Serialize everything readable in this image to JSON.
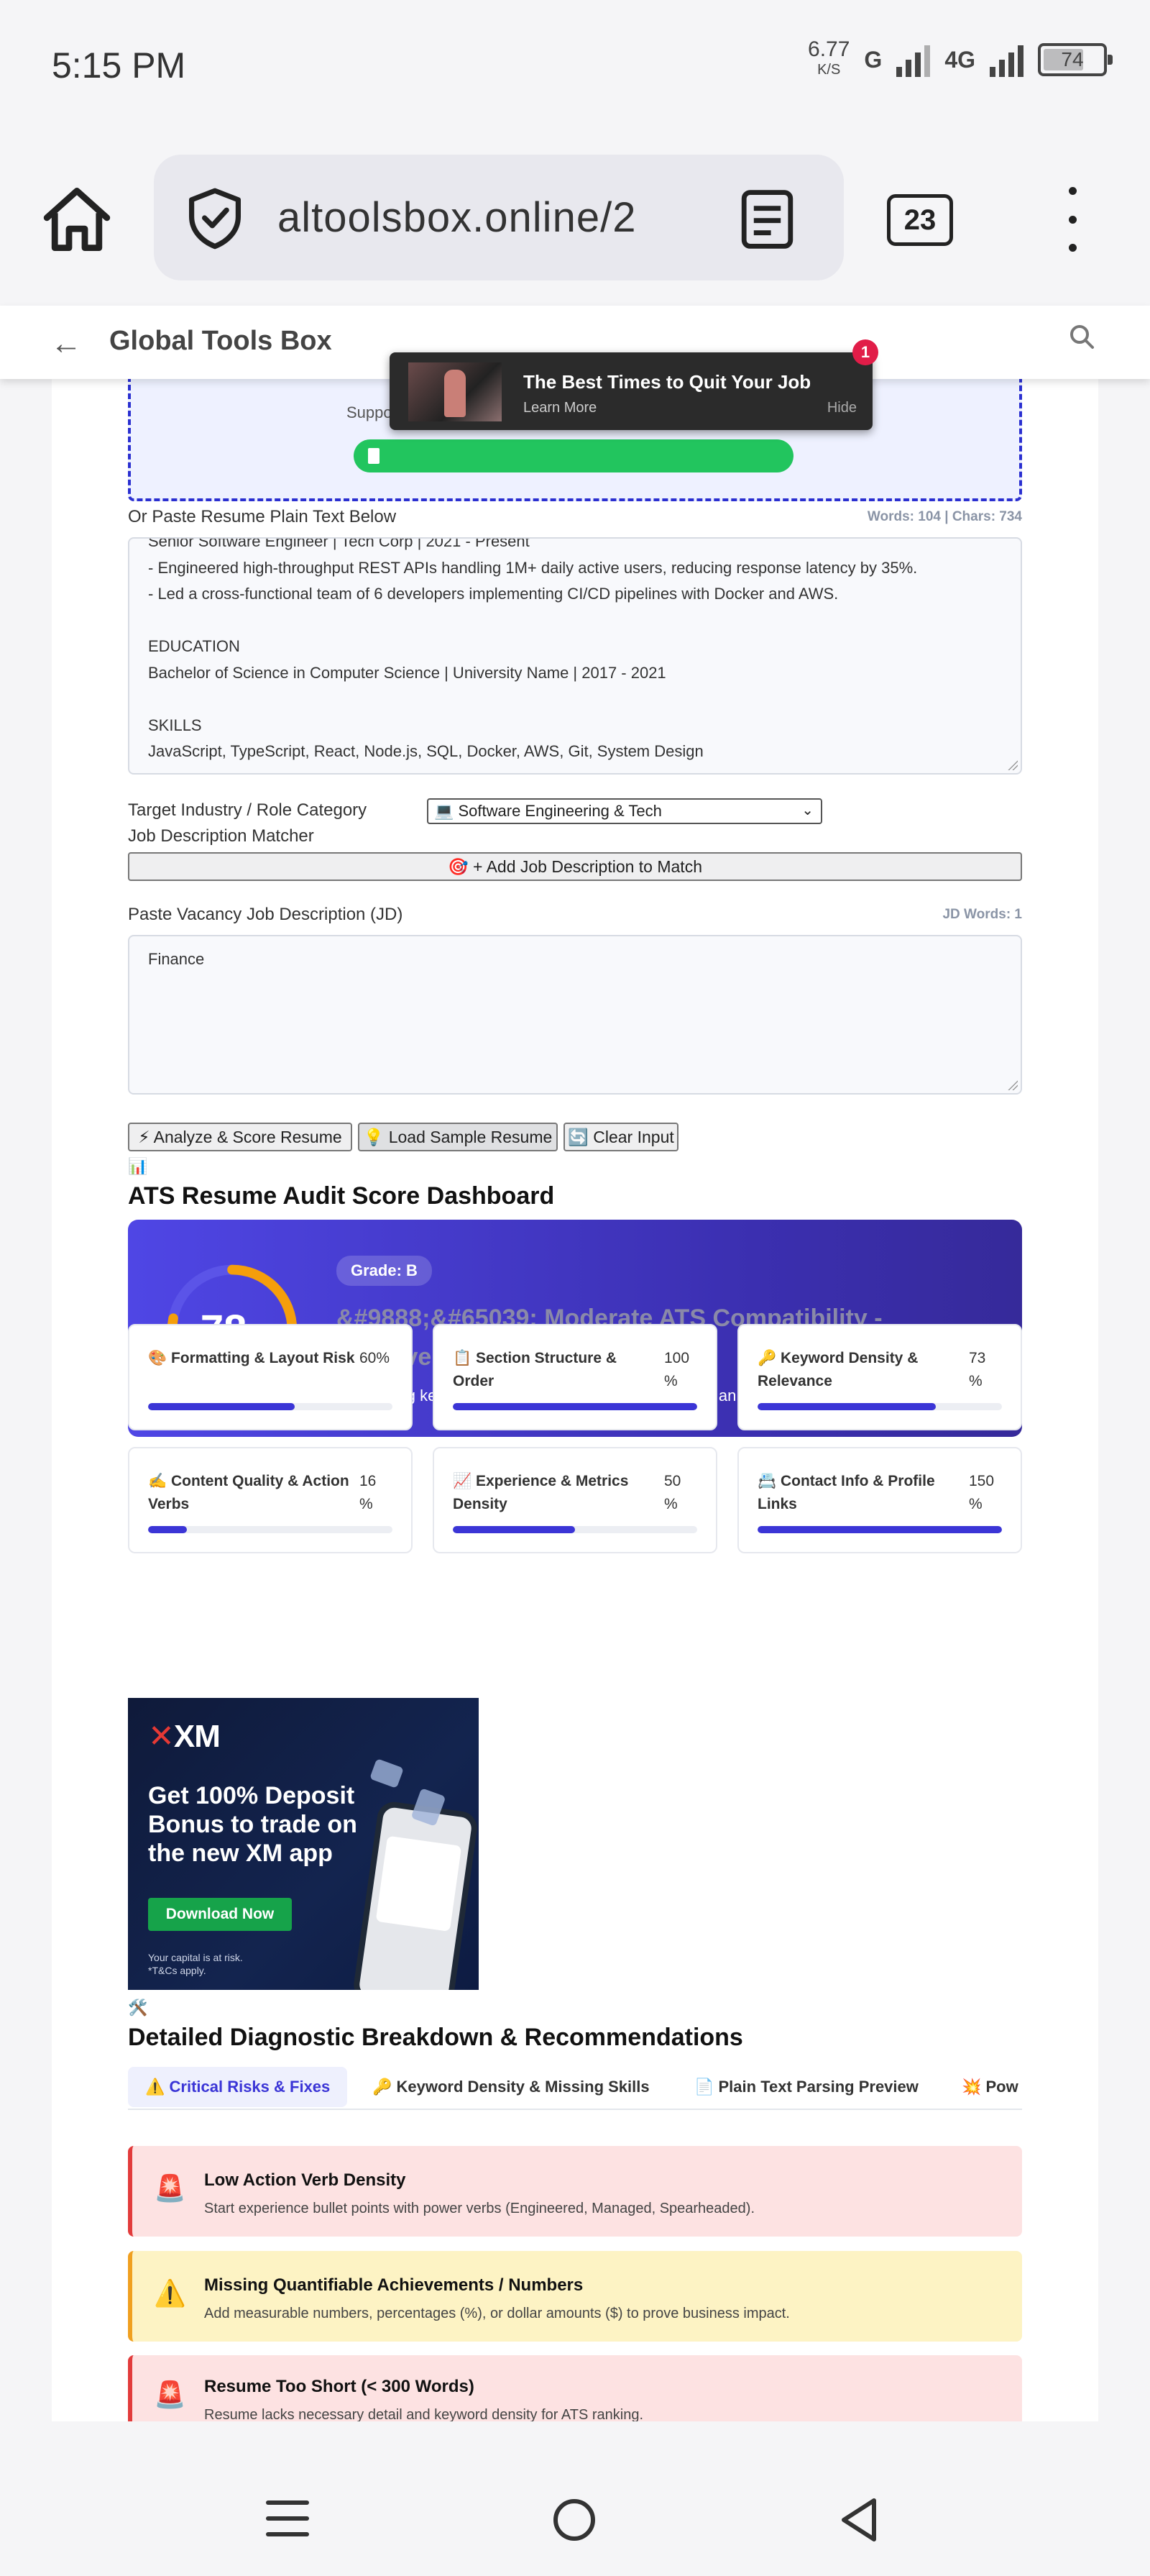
{
  "status": {
    "time": "5:15 PM",
    "net_speed": "6.77",
    "net_unit": "K/S",
    "sig1": "G",
    "sig2": "4G",
    "battery": "74"
  },
  "browser": {
    "url": "altoolsbox.online/2",
    "tab_count": "23"
  },
  "site": {
    "title": "Global Tools Box"
  },
  "toast": {
    "title": "The Best Times to Quit Your Job",
    "sub": "Learn More",
    "hide": "Hide",
    "badge": "1"
  },
  "upload": {
    "support_text": "Suppo"
  },
  "resume": {
    "label": "Or Paste Resume Plain Text Below",
    "counts": "Words: 104 | Chars: 734",
    "lines": [
      "Senior Software Engineer | Tech Corp | 2021 - Present",
      "- Engineered high-throughput REST APIs handling 1M+ daily active users, reducing response latency by 35%.",
      "- Led a cross-functional team of 6 developers implementing CI/CD pipelines with Docker and AWS.",
      "",
      "EDUCATION",
      "Bachelor of Science in Computer Science | University Name | 2017 - 2021",
      "",
      "SKILLS",
      "JavaScript, TypeScript, React, Node.js, SQL, Docker, AWS, Git, System Design"
    ]
  },
  "industry": {
    "label": "Target Industry / Role Category",
    "selected": "💻 Software Engineering & Tech"
  },
  "jd": {
    "matcher_label": "Job Description Matcher",
    "add_button": "🎯 + Add Job Description to Match",
    "label": "Paste Vacancy Job Description (JD)",
    "count": "JD Words: 1",
    "value": "Finance"
  },
  "actions": {
    "analyze": "⚡ Analyze & Score Resume",
    "sample": "💡 Load Sample Resume",
    "clear": "🔄 Clear Input"
  },
  "dashboard": {
    "icon": "📊",
    "title": "ATS Resume Audit Score Dashboard",
    "score": "78",
    "score_unit": "%",
    "score_value": 78,
    "grade": "Grade: B",
    "verdict": "&#9888;&#65039; Moderate ATS Compatibility - Improvements Recommended",
    "verdict_sub": "Fix missing keywords and action verbs below to reach an A+ score.",
    "colors": {
      "ring": "#f59e0b",
      "ring_track": "#5b54e8",
      "bar": "#3b35d6"
    }
  },
  "metrics": [
    {
      "title": "🎨 Formatting & Layout Risk",
      "value": "60%",
      "pct": 60
    },
    {
      "title": "📋 Section Structure & Order",
      "value": "100 %",
      "pct": 100
    },
    {
      "title": "🔑 Keyword Density & Relevance",
      "value": "73 %",
      "pct": 73
    },
    {
      "title": "✍️ Content Quality & Action Verbs",
      "value": "16 %",
      "pct": 16
    },
    {
      "title": "📈 Experience & Metrics Density",
      "value": "50 %",
      "pct": 50
    },
    {
      "title": "📇 Contact Info & Profile Links",
      "value": "150 %",
      "pct": 100
    }
  ],
  "ad": {
    "logo": "XM",
    "headline": "Get 100% Deposit Bonus to trade on the new XM app",
    "cta": "Download Now",
    "risk1": "Your capital is at risk.",
    "risk2": "*T&Cs apply."
  },
  "diagnostics": {
    "icon": "🛠️",
    "title": "Detailed Diagnostic Breakdown & Recommendations",
    "tabs": [
      "⚠️ Critical Risks & Fixes",
      "🔑 Keyword Density & Missing Skills",
      "📄 Plain Text Parsing Preview",
      "💥 Pow"
    ],
    "alerts": [
      {
        "icon": "🚨",
        "title": "Low Action Verb Density",
        "text": "Start experience bullet points with power verbs (Engineered, Managed, Spearheaded)."
      },
      {
        "icon": "⚠️",
        "title": "Missing Quantifiable Achievements / Numbers",
        "text": "Add measurable numbers, percentages (%), or dollar amounts ($) to prove business impact."
      },
      {
        "icon": "🚨",
        "title": "Resume Too Short (< 300 Words)",
        "text": "Resume lacks necessary detail and keyword density for ATS ranking."
      }
    ]
  }
}
